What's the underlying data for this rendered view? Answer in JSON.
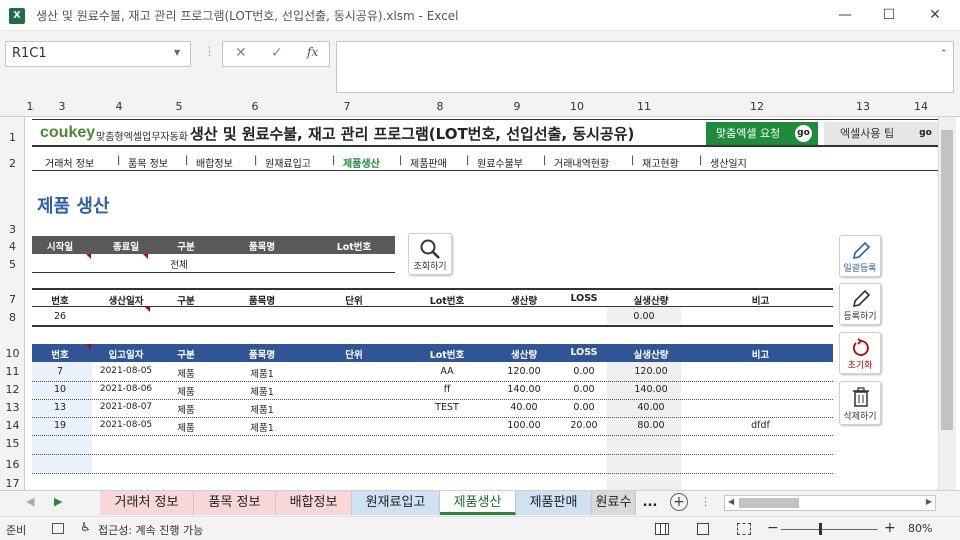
{
  "window": {
    "title": "생산 및 원료수불, 재고 관리 프로그램(LOT번호, 선입선출, 동시공유).xlsm - Excel",
    "app_icon": "X",
    "minimize": "—",
    "maximize": "☐",
    "close": "✕"
  },
  "formula": {
    "namebox": "R1C1",
    "cancel": "✕",
    "enter": "✓",
    "fx": "fx",
    "value": ""
  },
  "columns": [
    "1",
    "3",
    "4",
    "5",
    "6",
    "7",
    "8",
    "9",
    "10",
    "11",
    "12",
    "13",
    "14"
  ],
  "rows": [
    "1",
    "2",
    "3",
    "4",
    "5",
    "7",
    "8",
    "10",
    "11",
    "12",
    "13",
    "14",
    "15",
    "16",
    "17"
  ],
  "banner": {
    "logo": "coukey",
    "logo_sub": "맞춤형엑셀업무자동화",
    "title": "생산 및 원료수불, 재고 관리 프로그램(LOT번호, 선입선출, 동시공유)",
    "custom_btn": "맞춤엑셀 요청",
    "tips_btn": "엑셀사용 팁",
    "go": "go",
    "accent": "#1e8c3a"
  },
  "nav": [
    "거래처 정보",
    "품목 정보",
    "배합정보",
    "원재료입고",
    "제품생산",
    "제품판매",
    "원료수불부",
    "거래내역현황",
    "재고현황",
    "생산일지"
  ],
  "nav_active": "#1e8c3a",
  "page_title": "제품 생산",
  "search": {
    "headers": [
      "시작일",
      "종료일",
      "구분",
      "품목명",
      "Lot번호"
    ],
    "values": [
      "",
      "",
      "전체",
      "",
      ""
    ],
    "button": "조회하기"
  },
  "entry": {
    "headers": [
      "번호",
      "생산일자",
      "구분",
      "품목명",
      "단위",
      "Lot번호",
      "생산량",
      "LOSS",
      "실생산량",
      "비고"
    ],
    "values": [
      "26",
      "",
      "",
      "",
      "",
      "",
      "",
      "",
      "0.00",
      ""
    ]
  },
  "list": {
    "headers": [
      "번호",
      "입고일자",
      "구분",
      "품목명",
      "단위",
      "Lot번호",
      "생산량",
      "LOSS",
      "실생산량",
      "비고"
    ],
    "rows": [
      [
        "7",
        "2021-08-05",
        "제품",
        "제품1",
        "",
        "AA",
        "120.00",
        "0.00",
        "120.00",
        ""
      ],
      [
        "10",
        "2021-08-06",
        "제품",
        "제품1",
        "",
        "ff",
        "140.00",
        "0.00",
        "140.00",
        ""
      ],
      [
        "13",
        "2021-08-07",
        "제품",
        "제품1",
        "",
        "TEST",
        "40.00",
        "0.00",
        "40.00",
        ""
      ],
      [
        "19",
        "2021-08-05",
        "제품",
        "제품1",
        "",
        "",
        "100.00",
        "20.00",
        "80.00",
        "dfdf"
      ]
    ]
  },
  "side_buttons": [
    "일괄등록",
    "등록하기",
    "초기화",
    "삭제하기"
  ],
  "tabs": [
    "거래처 정보",
    "품목 정보",
    "배합정보",
    "원재료입고",
    "제품생산",
    "제품판매",
    "원료수",
    "..."
  ],
  "tab_colors": [
    "#f8d7d7",
    "#f8d7d7",
    "#f8d7d7",
    "#cfe2f3",
    "#ffffff",
    "#cfe2f3",
    "#d9d9d9",
    ""
  ],
  "status": {
    "ready": "준비",
    "accessibility": "접근성: 계속 진행 가능",
    "zoom": "80%",
    "minus": "−",
    "plus": "+"
  }
}
